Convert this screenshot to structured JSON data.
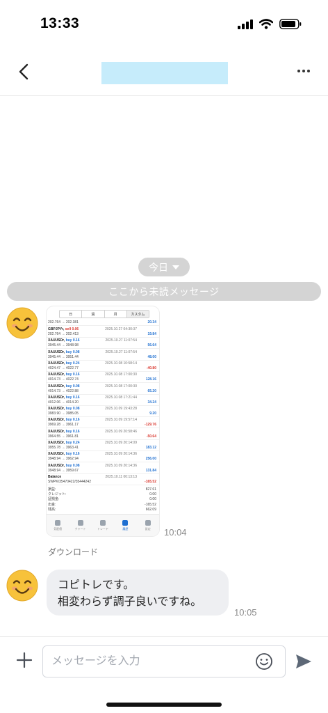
{
  "status_bar": {
    "time": "13:33"
  },
  "header": {
    "title": ""
  },
  "date_chip": {
    "label": "今日"
  },
  "unread_divider": {
    "label": "ここから未読メッセージ"
  },
  "image_message": {
    "time": "10:04",
    "download_label": "ダウンロード",
    "screenshot": {
      "tabs": [
        "日",
        "週",
        "月",
        "カスタム"
      ],
      "first_row": {
        "prices": "202.764 → 202.381",
        "profit": "20.34"
      },
      "deals": [
        {
          "symbol": "GBPJPYr,",
          "dir": "sell 0.06",
          "prices": "202.764 → 202.413",
          "datetime": "2025.10.27 04:30:37",
          "profit": "19.84"
        },
        {
          "symbol": "XAUUSDr,",
          "dir": "buy 0.16",
          "prices": "3945.44 → 3948.98",
          "datetime": "2025.10.27 11:07:54",
          "profit": "56.64"
        },
        {
          "symbol": "XAUUSDr,",
          "dir": "buy 0.08",
          "prices": "3945.44 → 3951.44",
          "datetime": "2025.10.27 11:07:54",
          "profit": "48.00"
        },
        {
          "symbol": "XAUUSDr,",
          "dir": "buy 0.24",
          "prices": "4024.47 → 4022.77",
          "datetime": "2025.10.08 10:58:14",
          "profit": "-40.80"
        },
        {
          "symbol": "XAUUSDr,",
          "dir": "buy 0.16",
          "prices": "4014.73 → 4022.74",
          "datetime": "2025.10.08 17:00:30",
          "profit": "128.16"
        },
        {
          "symbol": "XAUUSDr,",
          "dir": "buy 0.08",
          "prices": "4014.73 → 4022.88",
          "datetime": "2025.10.08 17:00:30",
          "profit": "65.20"
        },
        {
          "symbol": "XAUUSDr,",
          "dir": "buy 0.16",
          "prices": "4012.06 → 4014.20",
          "datetime": "2025.10.08 17:21:44",
          "profit": "34.24"
        },
        {
          "symbol": "XAUUSDr,",
          "dir": "buy 0.08",
          "prices": "3983.90 → 3985.05",
          "datetime": "2025.10.09 19:43:28",
          "profit": "9.20"
        },
        {
          "symbol": "XAUUSDr,",
          "dir": "buy 0.16",
          "prices": "3969.28 → 3961.17",
          "datetime": "2025.10.09 19:57:14",
          "profit": "-129.76"
        },
        {
          "symbol": "XAUUSDr,",
          "dir": "buy 0.16",
          "prices": "3964.55 → 3961.81",
          "datetime": "2025.10.09 20:58:46",
          "profit": "-50.64"
        },
        {
          "symbol": "XAUUSDr,",
          "dir": "buy 0.24",
          "prices": "3955.78 → 3963.41",
          "datetime": "2025.10.09 20:14:09",
          "profit": "183.12"
        },
        {
          "symbol": "XAUUSDr,",
          "dir": "buy 0.16",
          "prices": "3948.94 → 3962.94",
          "datetime": "2025.10.09 20:14:36",
          "profit": "256.00"
        },
        {
          "symbol": "XAUUSDr,",
          "dir": "buy 0.08",
          "prices": "3948.94 → 3959.67",
          "datetime": "2025.10.09 20:14:36",
          "profit": "131.84"
        }
      ],
      "balance": {
        "label": "Balance",
        "id": "SWPK/35470422/35444242",
        "datetime": "2025.10.11 00:13:13",
        "value": "-165.52"
      },
      "summary": [
        {
          "label": "損益:",
          "value": "827.61"
        },
        {
          "label": "クレジット:",
          "value": "0.00"
        },
        {
          "label": "証拠金:",
          "value": "0.00"
        },
        {
          "label": "出金:",
          "value": "-165.52"
        },
        {
          "label": "残高:",
          "value": "662.09"
        }
      ],
      "nav": [
        "気配値",
        "チャート",
        "トレード",
        "履歴",
        "設定"
      ]
    }
  },
  "text_message": {
    "line1": "コピトレです。",
    "line2": "相変わらず調子良いですね。",
    "time": "10:05"
  },
  "composer": {
    "placeholder": "メッセージを入力"
  },
  "colors": {
    "title_bg": "#c6ecfb",
    "pill_bg": "#d4d4d4",
    "bubble_bg": "#eeeff2",
    "accent_blue": "#1e6fd1",
    "negative_red": "#d9342b"
  }
}
